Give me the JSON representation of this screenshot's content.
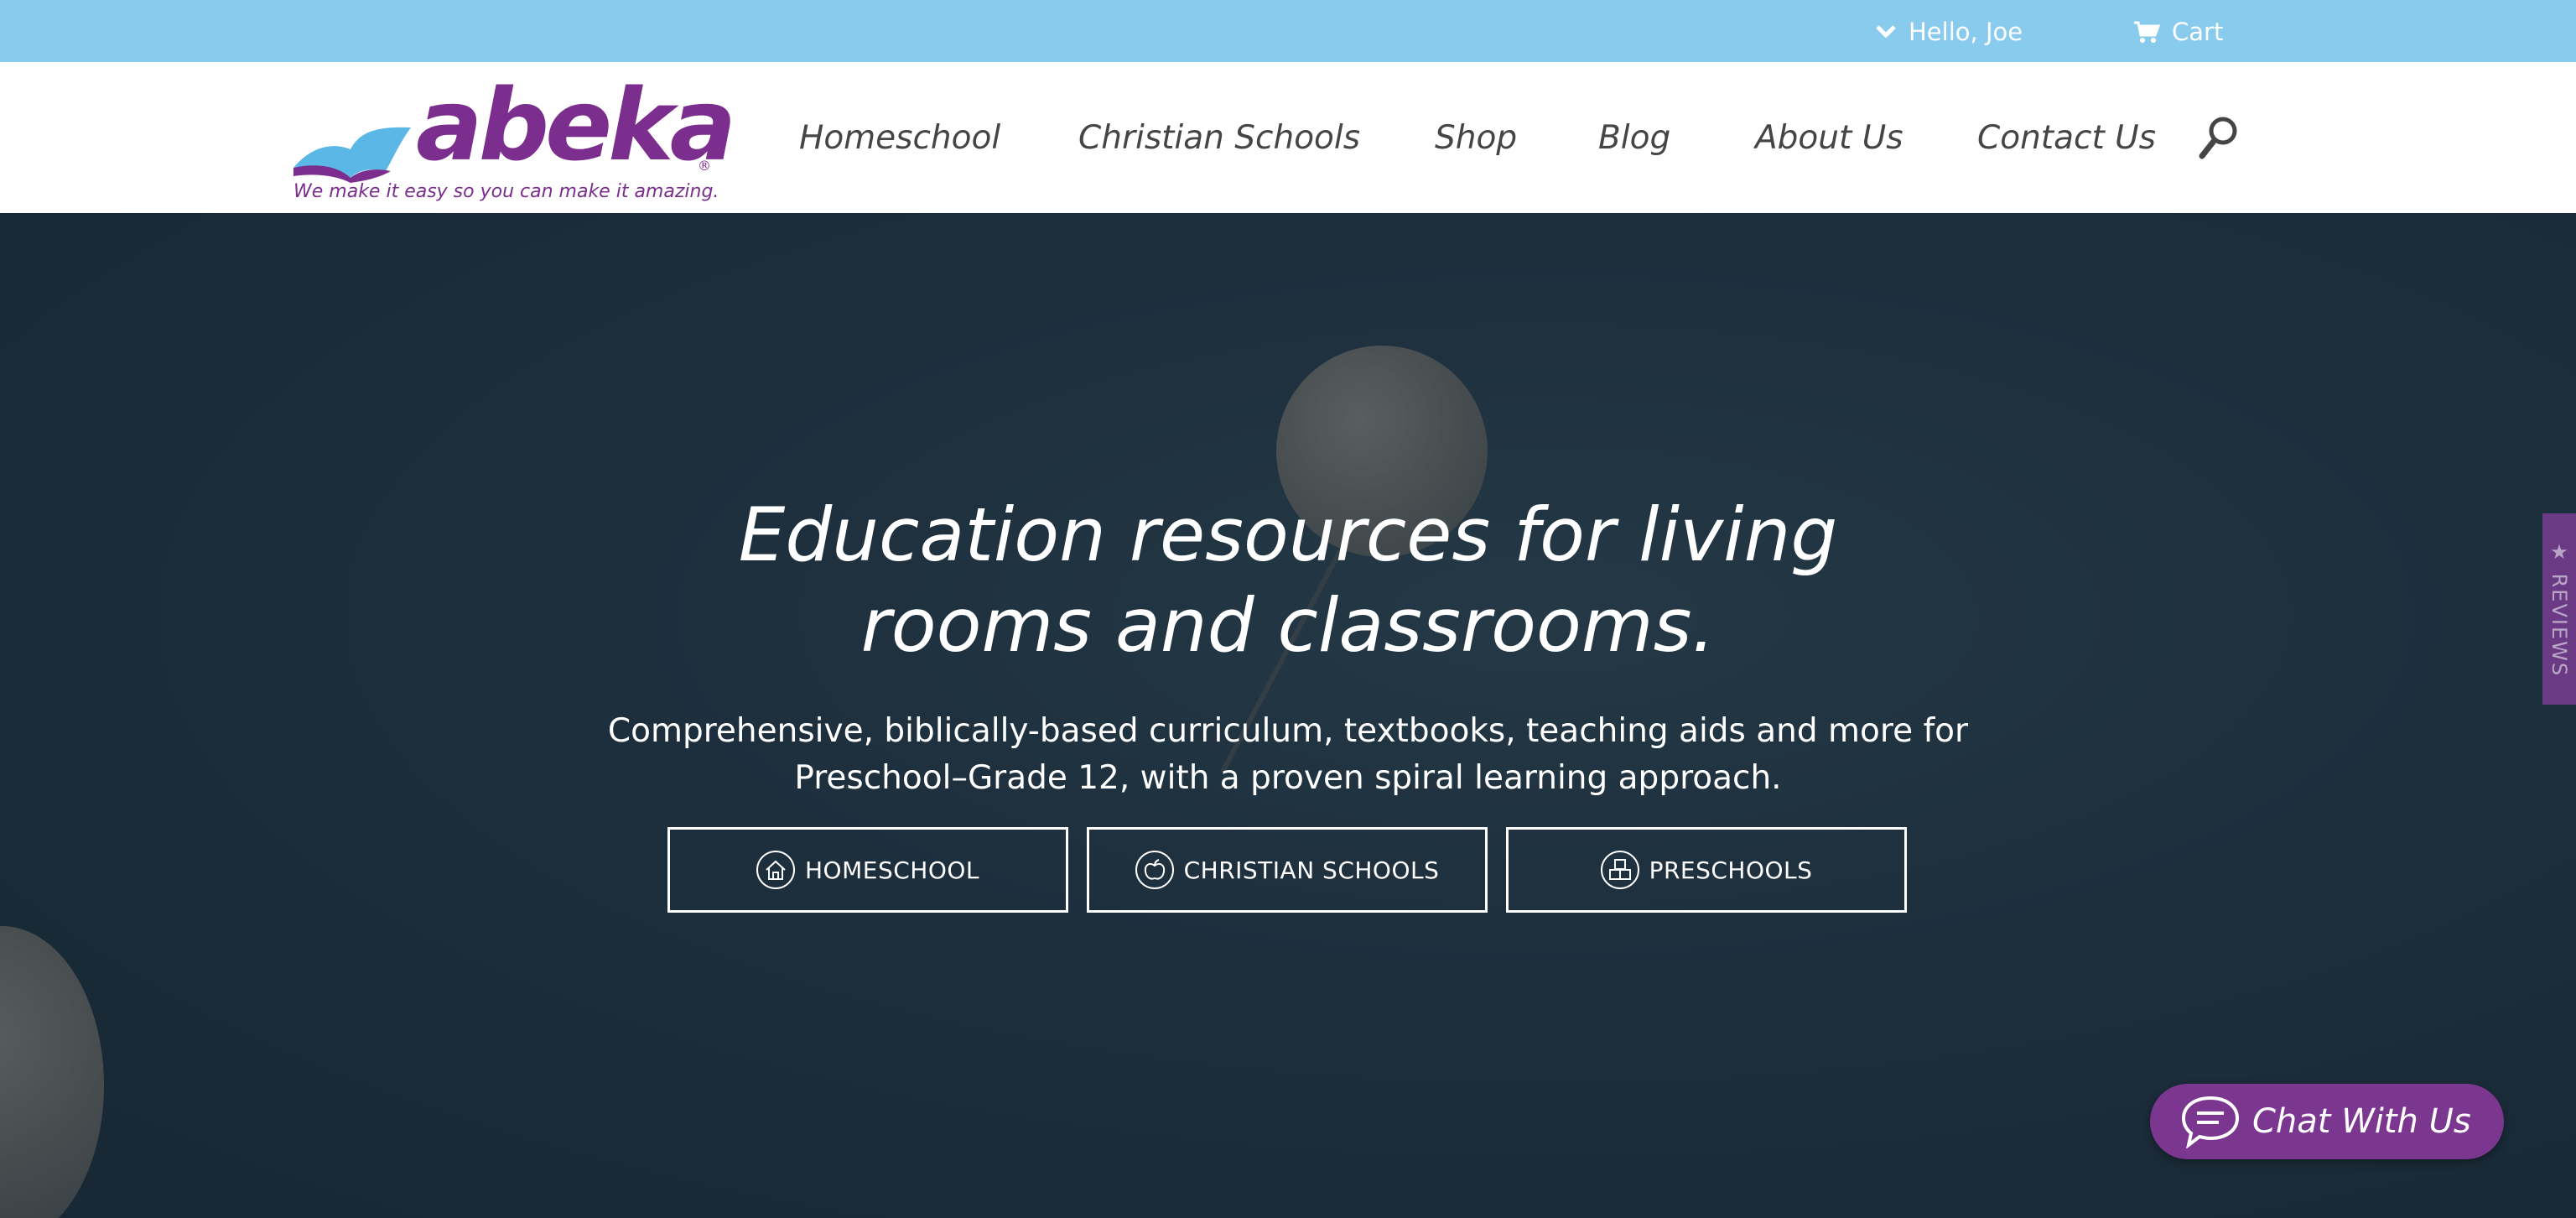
{
  "topbar": {
    "greeting": "Hello, Joe",
    "cart_label": "Cart"
  },
  "header": {
    "logo_text": "abeka",
    "logo_registered": "®",
    "tagline": "We make it easy so you can make it amazing.",
    "nav": [
      {
        "label": "Homeschool"
      },
      {
        "label": "Christian Schools"
      },
      {
        "label": "Shop"
      },
      {
        "label": "Blog"
      },
      {
        "label": "About Us"
      },
      {
        "label": "Contact Us"
      }
    ],
    "search_icon": "search-icon"
  },
  "hero": {
    "headline_line1": "Education resources for living",
    "headline_line2": "rooms and classrooms.",
    "subhead_line1": "Comprehensive, biblically-based curriculum, textbooks, teaching aids and more for",
    "subhead_line2": "Preschool–Grade 12, with a proven spiral learning approach.",
    "ctas": [
      {
        "label": "HOMESCHOOL",
        "icon": "house-icon"
      },
      {
        "label": "CHRISTIAN SCHOOLS",
        "icon": "apple-icon"
      },
      {
        "label": "PRESCHOOLS",
        "icon": "blocks-icon"
      }
    ]
  },
  "reviews_tab": {
    "label": "★ REVIEWS"
  },
  "chat": {
    "label": "Chat With Us",
    "icon": "chat-bubble-icon"
  },
  "colors": {
    "topbar": "#88cbec",
    "brand_purple": "#7b2e8e",
    "logo_blue": "#5bb8e6",
    "nav_text": "#454545",
    "hero_bg": "#223543",
    "chat_bg": "#7b378f",
    "reviews_bg": "#6b3a84"
  }
}
